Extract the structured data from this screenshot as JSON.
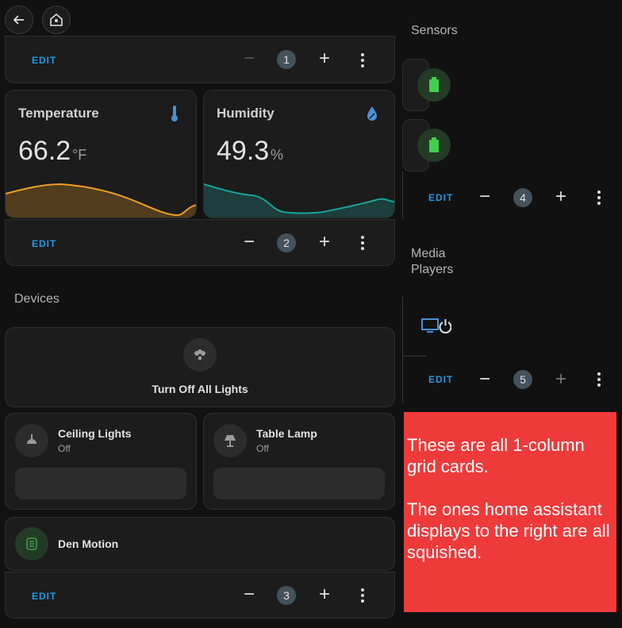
{
  "toolbar": {
    "back": "back",
    "home": "home"
  },
  "sections": {
    "sensors": "Sensors",
    "media_players": "Media\nPlayers",
    "devices": "Devices"
  },
  "controls": {
    "edit_label": "EDIT"
  },
  "badges": {
    "b1": "1",
    "b2": "2",
    "b3": "3",
    "b4": "4",
    "b5": "5"
  },
  "temperature": {
    "title": "Temperature",
    "value": "66.2",
    "unit": "°F"
  },
  "humidity": {
    "title": "Humidity",
    "value": "49.3",
    "unit": "%"
  },
  "devices": {
    "all_lights": "Turn Off All Lights",
    "ceiling": {
      "name": "Ceiling Lights",
      "state": "Off"
    },
    "table_lamp": {
      "name": "Table Lamp",
      "state": "Off"
    },
    "den_motion": {
      "name": "Den Motion"
    }
  },
  "note": {
    "line1": "These are all 1-column grid cards.",
    "line2": "The ones home assistant displays to the right are all squished."
  },
  "colors": {
    "accent": "#1e9be6",
    "temp_line": "#f0a020",
    "hum_line": "#1aa39a",
    "note_bg": "#ef3a3a",
    "motion": "#3fa34d"
  },
  "icons": [
    "arrow-left-icon",
    "home-assistant-icon",
    "thermometer-icon",
    "water-percent-icon",
    "lightbulb-group-icon",
    "ceiling-light-icon",
    "floor-lamp-icon",
    "motion-sensor-icon",
    "battery-icon",
    "tv-power-icon"
  ]
}
